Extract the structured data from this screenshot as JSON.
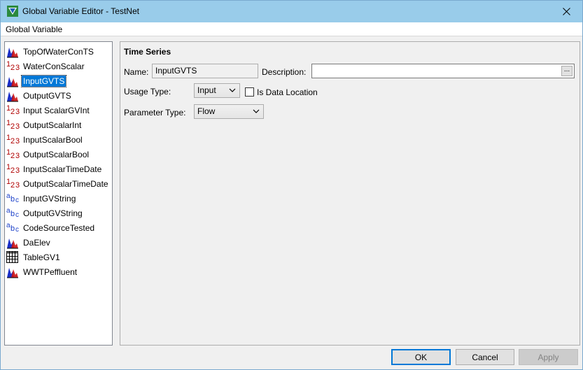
{
  "window": {
    "title": "Global Variable Editor - TestNet",
    "close_label": "✕"
  },
  "menu": {
    "items": [
      "Global Variable"
    ]
  },
  "tree": {
    "items": [
      {
        "label": "TopOfWaterConTS",
        "icon": "timeseries-icon"
      },
      {
        "label": "WaterConScalar",
        "icon": "numeric-icon"
      },
      {
        "label": "InputGVTS",
        "icon": "timeseries-icon",
        "selected": true
      },
      {
        "label": "OutputGVTS",
        "icon": "timeseries-icon"
      },
      {
        "label": "Input ScalarGVInt",
        "icon": "numeric-icon"
      },
      {
        "label": "OutputScalarInt",
        "icon": "numeric-icon"
      },
      {
        "label": "InputScalarBool",
        "icon": "numeric-icon"
      },
      {
        "label": "OutputScalarBool",
        "icon": "numeric-icon"
      },
      {
        "label": "InputScalarTimeDate",
        "icon": "numeric-icon"
      },
      {
        "label": "OutputScalarTimeDate",
        "icon": "numeric-icon"
      },
      {
        "label": "InputGVString",
        "icon": "string-icon"
      },
      {
        "label": "OutputGVString",
        "icon": "string-icon"
      },
      {
        "label": "CodeSourceTested",
        "icon": "string-icon"
      },
      {
        "label": "DaElev",
        "icon": "timeseries-icon"
      },
      {
        "label": "TableGV1",
        "icon": "table-icon"
      },
      {
        "label": "WWTPeffluent",
        "icon": "timeseries-icon"
      }
    ]
  },
  "detail": {
    "section_title": "Time Series",
    "name_label": "Name:",
    "name_value": "InputGVTS",
    "description_label": "Description:",
    "description_value": "",
    "description_button": "...",
    "usage_type_label": "Usage Type:",
    "usage_type_value": "Input",
    "is_data_location_label": "Is Data Location",
    "is_data_location_checked": false,
    "parameter_type_label": "Parameter Type:",
    "parameter_type_value": "Flow"
  },
  "buttons": {
    "ok": "OK",
    "cancel": "Cancel",
    "apply": "Apply"
  },
  "colors": {
    "titlebar": "#99ccea",
    "selection": "#0078d7",
    "numeric_icon": "#b00000",
    "string_icon": "#1a3fc9"
  }
}
